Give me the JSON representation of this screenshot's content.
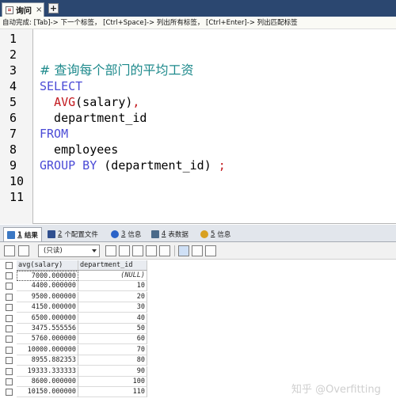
{
  "query_tab": {
    "label": "询问",
    "close": "×",
    "add": "+"
  },
  "hint": "自动完成: [Tab]-> 下一个标签， [Ctrl+Space]-> 列出所有标签， [Ctrl+Enter]-> 列出匹配标签",
  "editor": {
    "lines": [
      {
        "n": "1",
        "parts": []
      },
      {
        "n": "2",
        "parts": []
      },
      {
        "n": "3",
        "parts": [
          {
            "t": "# 查询每个部门的平均工资",
            "c": "cm"
          }
        ]
      },
      {
        "n": "4",
        "parts": [
          {
            "t": "SELECT",
            "c": "kw"
          }
        ]
      },
      {
        "n": "5",
        "parts": [
          {
            "t": "  ",
            "c": "plain"
          },
          {
            "t": "AVG",
            "c": "fn"
          },
          {
            "t": "(salary)",
            "c": "plain"
          },
          {
            "t": ",",
            "c": "fn"
          }
        ]
      },
      {
        "n": "6",
        "parts": [
          {
            "t": "  department_id",
            "c": "plain"
          }
        ]
      },
      {
        "n": "7",
        "parts": [
          {
            "t": "FROM",
            "c": "kw"
          }
        ]
      },
      {
        "n": "8",
        "parts": [
          {
            "t": "  employees",
            "c": "plain"
          }
        ]
      },
      {
        "n": "9",
        "parts": [
          {
            "t": "GROUP BY",
            "c": "kw"
          },
          {
            "t": " (department_id)",
            "c": "plain"
          },
          {
            "t": " ;",
            "c": "fn"
          }
        ]
      },
      {
        "n": "10",
        "parts": []
      },
      {
        "n": "11",
        "parts": []
      }
    ]
  },
  "result_tabs": [
    {
      "num": "1",
      "label": "结果",
      "icon": "grid-icon",
      "color": "#3b78c4",
      "active": true
    },
    {
      "num": "2",
      "label": "个配置文件",
      "icon": "profile-icon",
      "color": "#2f4f8f",
      "active": false
    },
    {
      "num": "3",
      "label": "信息",
      "icon": "info-icon",
      "color": "#2a62c8",
      "active": false
    },
    {
      "num": "4",
      "label": "表数据",
      "icon": "table-data-icon",
      "color": "#4a6a8a",
      "active": false
    },
    {
      "num": "5",
      "label": "信息",
      "icon": "info-status-icon",
      "color": "#d8a020",
      "active": false
    }
  ],
  "toolbar": {
    "mode_select": "(只读)"
  },
  "grid": {
    "columns": [
      "avg(salary)",
      "department_id"
    ],
    "rows": [
      [
        "7000.000000",
        "(NULL)"
      ],
      [
        "4400.000000",
        "10"
      ],
      [
        "9500.000000",
        "20"
      ],
      [
        "4150.000000",
        "30"
      ],
      [
        "6500.000000",
        "40"
      ],
      [
        "3475.555556",
        "50"
      ],
      [
        "5760.000000",
        "60"
      ],
      [
        "10000.000000",
        "70"
      ],
      [
        "8955.882353",
        "80"
      ],
      [
        "19333.333333",
        "90"
      ],
      [
        "8600.000000",
        "100"
      ],
      [
        "10150.000000",
        "110"
      ]
    ]
  },
  "watermark": "知乎 @Overfitting"
}
